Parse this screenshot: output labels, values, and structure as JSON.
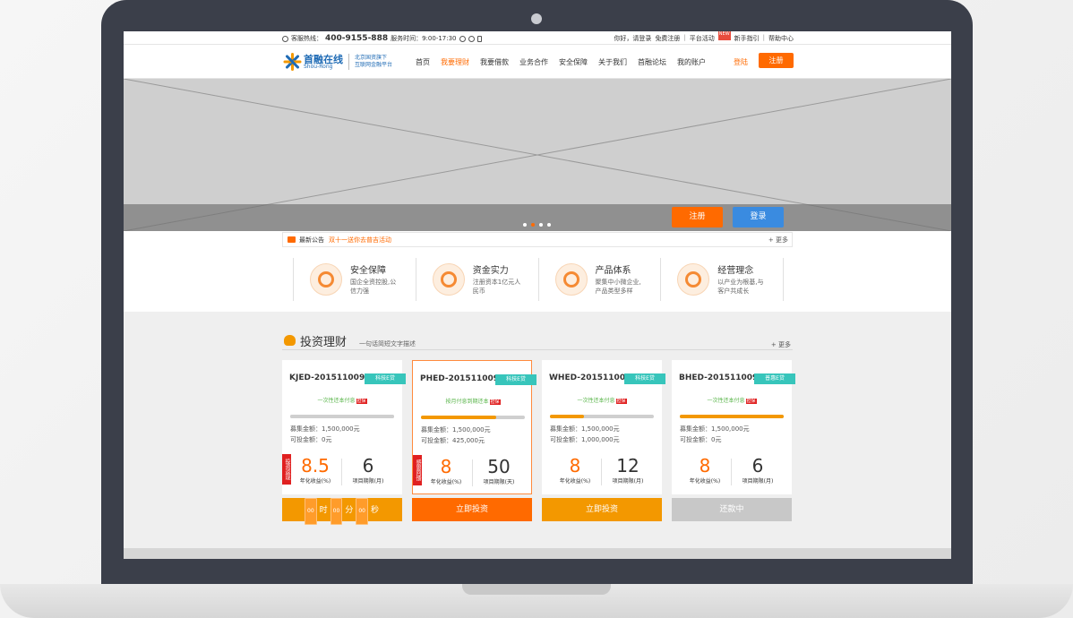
{
  "topbar": {
    "hotline_label": "客服热线：",
    "hotline": "400-9155-888",
    "hours": "服务时间：9:00-17:30",
    "greeting": "你好，请登录",
    "free_register": "免费注册",
    "platform_activity": "平台活动",
    "new_tag": "NEW",
    "newbie_guide": "新手指引",
    "help_center": "帮助中心"
  },
  "header": {
    "logo_cn": "首融在线",
    "logo_en": "Shou-Rong",
    "slogan_line1": "北京国资旗下",
    "slogan_line2": "互联网金融平台",
    "nav": [
      "首页",
      "我要理财",
      "我要借款",
      "业务合作",
      "安全保障",
      "关于我们",
      "首融论坛",
      "我的账户"
    ],
    "login": "登陆",
    "register": "注册"
  },
  "banner": {
    "register_button": "注册",
    "login_button": "登录",
    "slide_count": 4,
    "active_slide": 2
  },
  "notice": {
    "label": "最新公告",
    "message": "双十一送你去普吉活动",
    "more": "更多"
  },
  "features": [
    {
      "title": "安全保障",
      "desc": "国企全资控股,公信力强"
    },
    {
      "title": "资金实力",
      "desc": "注册资本1亿元人民币"
    },
    {
      "title": "产品体系",
      "desc": "聚集中小微企业,产品类型多样"
    },
    {
      "title": "经营理念",
      "desc": "以产业为根基,与客户共成长"
    }
  ],
  "invest": {
    "title": "投资理财",
    "subtitle": "一句话简短文字描述",
    "more": "更多"
  },
  "cards": [
    {
      "code": "KJED-201511009",
      "tag": "科技E贷",
      "repay": "一次性还本付息",
      "badge": "担保",
      "progress": 1.0,
      "progress_color": "#cfcfcf",
      "amount_label": "募集金额：",
      "amount": "1,500,000元",
      "avail_label": "可投金额：",
      "avail": "0元",
      "ribbon": "投资返现",
      "rate": "8.5",
      "rate_label": "年化收益(%)",
      "term": "6",
      "term_label": "项目期限(月)",
      "button": "",
      "countdown": [
        "00",
        "时",
        "00",
        "分",
        "00",
        "秒"
      ],
      "highlight": false
    },
    {
      "code": "PHED-201511009",
      "tag": "科技E贷",
      "repay": "按月付息到期还本",
      "badge": "担保",
      "progress": 0.72,
      "progress_color": "#f39800",
      "amount_label": "募集金额：",
      "amount": "1,500,000元",
      "avail_label": "可投金额：",
      "avail": "425,000元",
      "ribbon": "感恩回馈",
      "rate": "8",
      "rate_label": "年化收益(%)",
      "term": "50",
      "term_label": "项目期限(天)",
      "button": "立即投资",
      "highlight": true
    },
    {
      "code": "WHED-201511009",
      "tag": "科技E贷",
      "repay": "一次性还本付息",
      "badge": "担保",
      "progress": 0.33,
      "progress_color": "#f39800",
      "amount_label": "募集金额：",
      "amount": "1,500,000元",
      "avail_label": "可投金额：",
      "avail": "1,000,000元",
      "ribbon": "",
      "rate": "8",
      "rate_label": "年化收益(%)",
      "term": "12",
      "term_label": "项目期限(月)",
      "button": "立即投资",
      "highlight": false
    },
    {
      "code": "BHED-201511009",
      "tag": "普惠E贷",
      "repay": "一次性还本付息",
      "badge": "担保",
      "progress": 1.0,
      "progress_color": "#f39800",
      "amount_label": "募集金额：",
      "amount": "1,500,000元",
      "avail_label": "可投金额：",
      "avail": "0元",
      "ribbon": "",
      "rate": "8",
      "rate_label": "年化收益(%)",
      "term": "6",
      "term_label": "项目期限(月)",
      "button": "还款中",
      "highlight": false
    }
  ]
}
